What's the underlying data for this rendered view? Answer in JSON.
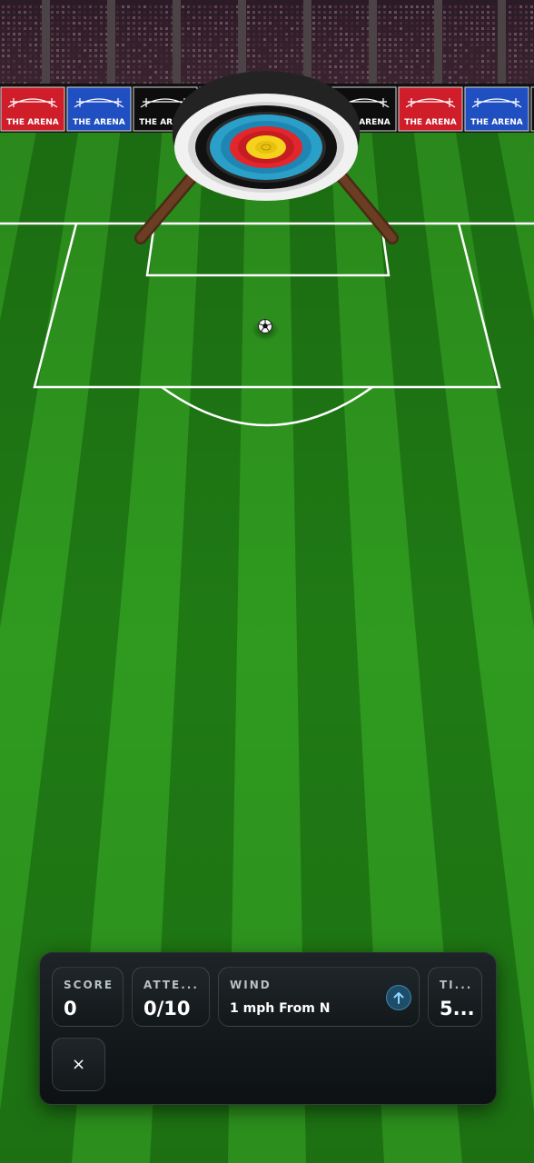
{
  "banner": {
    "text": "THE ARENA",
    "colors": [
      "#cf1d2a",
      "#1f4fc0",
      "#0d0d0d"
    ]
  },
  "target": {
    "rings": [
      "white",
      "black",
      "blue",
      "red",
      "gold"
    ]
  },
  "ball": {
    "icon": "soccer-ball"
  },
  "hud": {
    "score": {
      "label": "SCORE",
      "value": "0"
    },
    "attempts": {
      "label": "ATTE...",
      "value": "0/10"
    },
    "wind": {
      "label": "WIND",
      "value": "1 mph From N",
      "icon": "arrow-up-icon"
    },
    "time": {
      "label": "TI...",
      "value": "5..."
    },
    "close": {
      "label": "×",
      "icon": "close-icon"
    }
  },
  "colors": {
    "grass_light": "#2f9a1f",
    "grass_dark": "#1f7a14",
    "wind_accent": "#7fd0ff"
  }
}
